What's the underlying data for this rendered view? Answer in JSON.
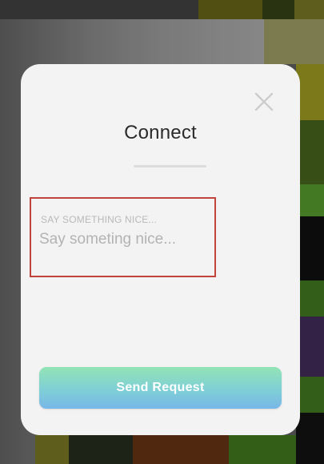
{
  "modal": {
    "title": "Connect",
    "close_icon": "close-icon",
    "message_field": {
      "label": "SAY SOMETHING NICE...",
      "placeholder": "Say someting nice...",
      "value": ""
    },
    "send_button_label": "Send Request"
  },
  "colors": {
    "modal_background": "#f3f3f3",
    "field_border": "#c0443a",
    "button_gradient_top": "#92e4b5",
    "button_gradient_bottom": "#78b6e8",
    "button_text": "#ffffff"
  }
}
